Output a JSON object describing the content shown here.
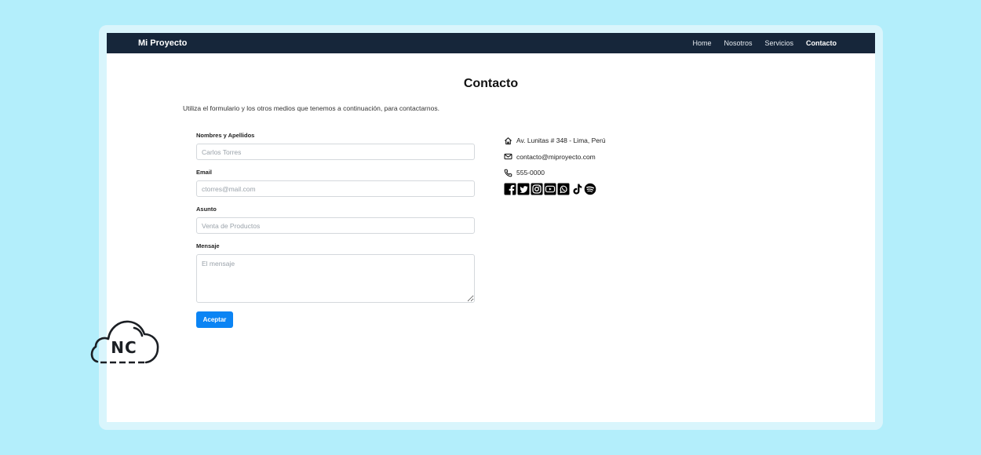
{
  "navbar": {
    "brand": "Mi Proyecto",
    "links": [
      {
        "label": "Home"
      },
      {
        "label": "Nosotros"
      },
      {
        "label": "Servicios"
      },
      {
        "label": "Contacto",
        "active": true
      }
    ]
  },
  "page": {
    "title": "Contacto",
    "intro": "Utiliza el formulario y los otros medios que tenemos a continuación, para contactarnos."
  },
  "form": {
    "name_label": "Nombres y Apellidos",
    "name_placeholder": "Carlos Torres",
    "email_label": "Email",
    "email_placeholder": "ctorres@mail.com",
    "subject_label": "Asunto",
    "subject_placeholder": "Venta de Productos",
    "message_label": "Mensaje",
    "message_placeholder": "El mensaje",
    "submit_label": "Aceptar"
  },
  "contact_info": {
    "address": "Av. Lunitas # 348 - Lima, Perú",
    "email": "contacto@miproyecto.com",
    "phone": "555-0000",
    "socials": [
      "facebook-icon",
      "twitter-icon",
      "instagram-icon",
      "youtube-icon",
      "whatsapp-icon",
      "tiktok-icon",
      "spotify-icon"
    ]
  },
  "watermark": {
    "text": "NC"
  },
  "colors": {
    "background": "#b3eefb",
    "navbar": "#16263a",
    "button": "#0b84f4"
  }
}
